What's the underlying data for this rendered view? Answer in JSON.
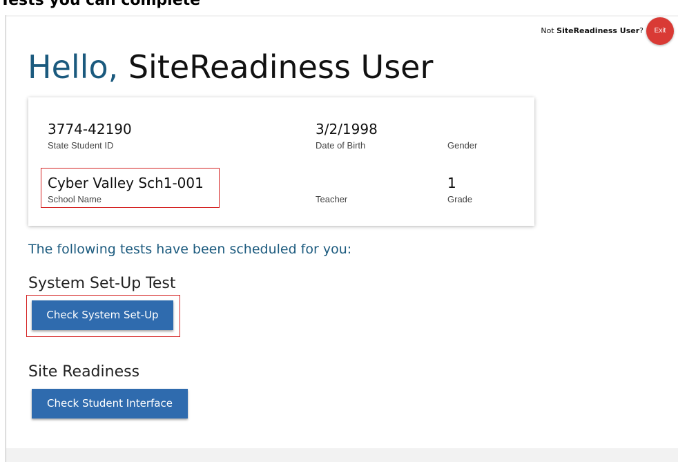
{
  "top_caption": "Tests you can complete",
  "header": {
    "not_prefix": "Not ",
    "user_name": "SiteReadiness User",
    "not_suffix": "?",
    "exit_label": "Exit"
  },
  "greeting": {
    "hello": "Hello,",
    "name": "SiteReadiness User"
  },
  "student": {
    "state_id": {
      "value": "3774-42190",
      "label": "State Student ID"
    },
    "dob": {
      "value": "3/2/1998",
      "label": "Date of Birth"
    },
    "gender": {
      "value": "",
      "label": "Gender"
    },
    "school": {
      "value": "Cyber Valley Sch1-001",
      "label": "School Name"
    },
    "teacher": {
      "value": "",
      "label": "Teacher"
    },
    "grade": {
      "value": "1",
      "label": "Grade"
    }
  },
  "scheduled_text": "The following tests have been scheduled for you:",
  "sections": {
    "system_setup": {
      "title": "System Set-Up Test",
      "button": "Check System Set-Up"
    },
    "site_readiness": {
      "title": "Site Readiness",
      "button": "Check Student Interface"
    }
  },
  "colors": {
    "accent_text": "#1b5a7e",
    "button_bg": "#2f6bae",
    "exit_bg": "#d93a35",
    "highlight": "#d42020"
  }
}
